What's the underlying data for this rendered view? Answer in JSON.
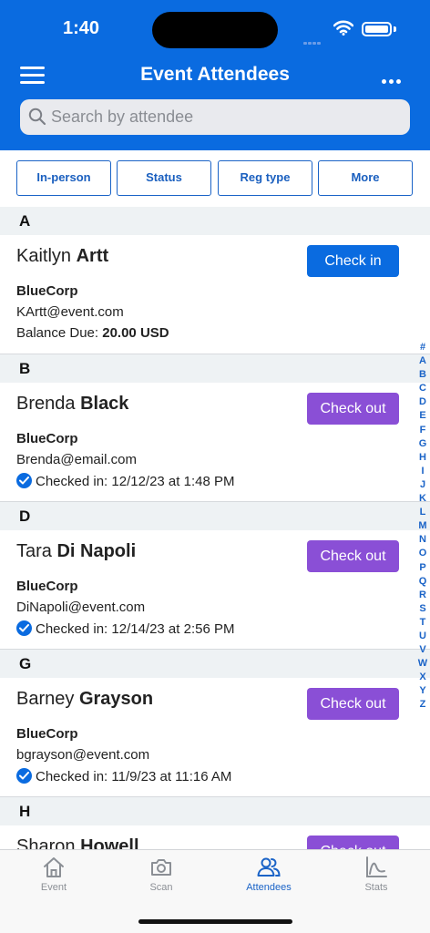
{
  "status_bar": {
    "time": "1:40"
  },
  "header": {
    "title": "Event Attendees"
  },
  "search": {
    "placeholder": "Search by attendee"
  },
  "filters": [
    "In-person",
    "Status",
    "Reg type",
    "More"
  ],
  "sections": [
    {
      "letter": "A"
    },
    {
      "letter": "B"
    },
    {
      "letter": "D"
    },
    {
      "letter": "G"
    },
    {
      "letter": "H"
    }
  ],
  "attendees": [
    {
      "first": "Kaitlyn",
      "last": "Artt",
      "company": "BlueCorp",
      "email": "KArtt@event.com",
      "detail_label": "Balance Due:",
      "detail_value": "20.00 USD",
      "action": "Check in"
    },
    {
      "first": "Brenda",
      "last": "Black",
      "company": "BlueCorp",
      "email": "Brenda@email.com",
      "detail_label": "Checked in: 12/12/23 at 1:48 PM",
      "action": "Check out"
    },
    {
      "first": "Tara",
      "last": "Di Napoli",
      "company": "BlueCorp",
      "email": "DiNapoli@event.com",
      "detail_label": "Checked in: 12/14/23 at 2:56 PM",
      "action": "Check out"
    },
    {
      "first": "Barney",
      "last": "Grayson",
      "company": "BlueCorp",
      "email": "bgrayson@event.com",
      "detail_label": "Checked in: 11/9/23 at 11:16 AM",
      "action": "Check out"
    },
    {
      "first": "Sharon",
      "last": "Howell",
      "action": "Check out"
    }
  ],
  "alpha_index": [
    "#",
    "A",
    "B",
    "C",
    "D",
    "E",
    "F",
    "G",
    "H",
    "I",
    "J",
    "K",
    "L",
    "M",
    "N",
    "O",
    "P",
    "Q",
    "R",
    "S",
    "T",
    "U",
    "V",
    "W",
    "X",
    "Y",
    "Z"
  ],
  "tabs": [
    {
      "label": "Event",
      "icon": "home-icon"
    },
    {
      "label": "Scan",
      "icon": "camera-icon"
    },
    {
      "label": "Attendees",
      "icon": "people-icon",
      "active": true
    },
    {
      "label": "Stats",
      "icon": "chart-icon"
    }
  ],
  "colors": {
    "primary": "#0a6be0",
    "checkout": "#8a4fd6",
    "section_bg": "#eef2f4"
  }
}
